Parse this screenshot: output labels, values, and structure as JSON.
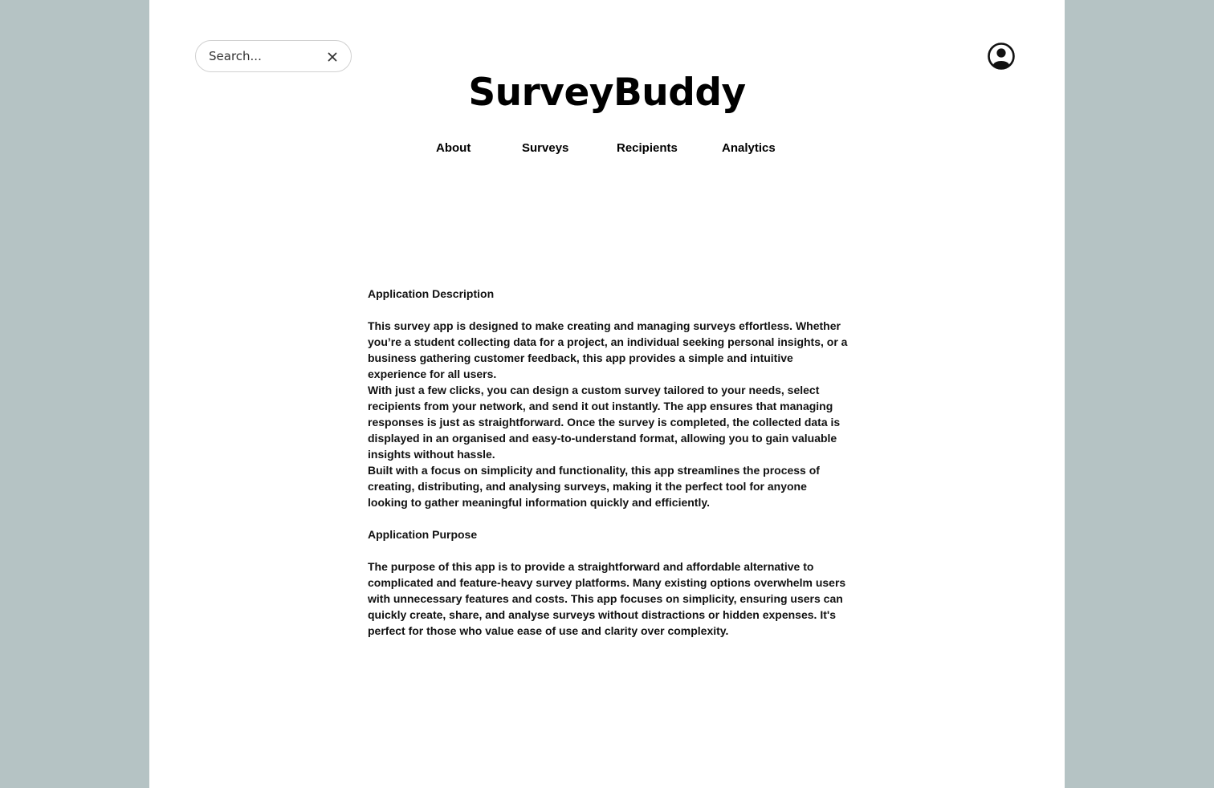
{
  "app": {
    "title": "SurveyBuddy"
  },
  "search": {
    "placeholder": "Search...",
    "clear_icon": "close-icon"
  },
  "header": {
    "avatar_icon": "user-circle-icon"
  },
  "nav": {
    "items": [
      {
        "label": "About"
      },
      {
        "label": "Surveys"
      },
      {
        "label": "Recipients"
      },
      {
        "label": "Analytics"
      }
    ]
  },
  "content": {
    "description_heading": "Application Description",
    "description_paragraphs": [
      "This survey app is designed to make creating and managing surveys effortless. Whether you’re a student collecting data for a project, an individual seeking personal insights, or a business gathering customer feedback, this app provides a simple and intuitive experience for all users.",
      "With just a few clicks, you can design a custom survey tailored to your needs, select recipients from your network, and send it out instantly. The app ensures that managing responses is just as straightforward. Once the survey is completed, the collected data is displayed in an organised and easy-to-understand format, allowing you to gain valuable insights without hassle.",
      "Built with a focus on simplicity and functionality, this app streamlines the process of creating, distributing, and analysing surveys, making it the perfect tool for anyone looking to gather meaningful information quickly and efficiently."
    ],
    "purpose_heading": "Application Purpose",
    "purpose_paragraph": "The purpose of this app is to provide a straightforward and affordable alternative to complicated and feature-heavy survey platforms. Many existing options overwhelm users with unnecessary features and costs. This app focuses on simplicity, ensuring users can quickly create, share, and analyse surveys without distractions or hidden expenses. It's perfect for those who value ease of use and clarity over complexity."
  },
  "colors": {
    "background": "#b5c3c4",
    "page": "#ffffff",
    "text": "#000000"
  }
}
